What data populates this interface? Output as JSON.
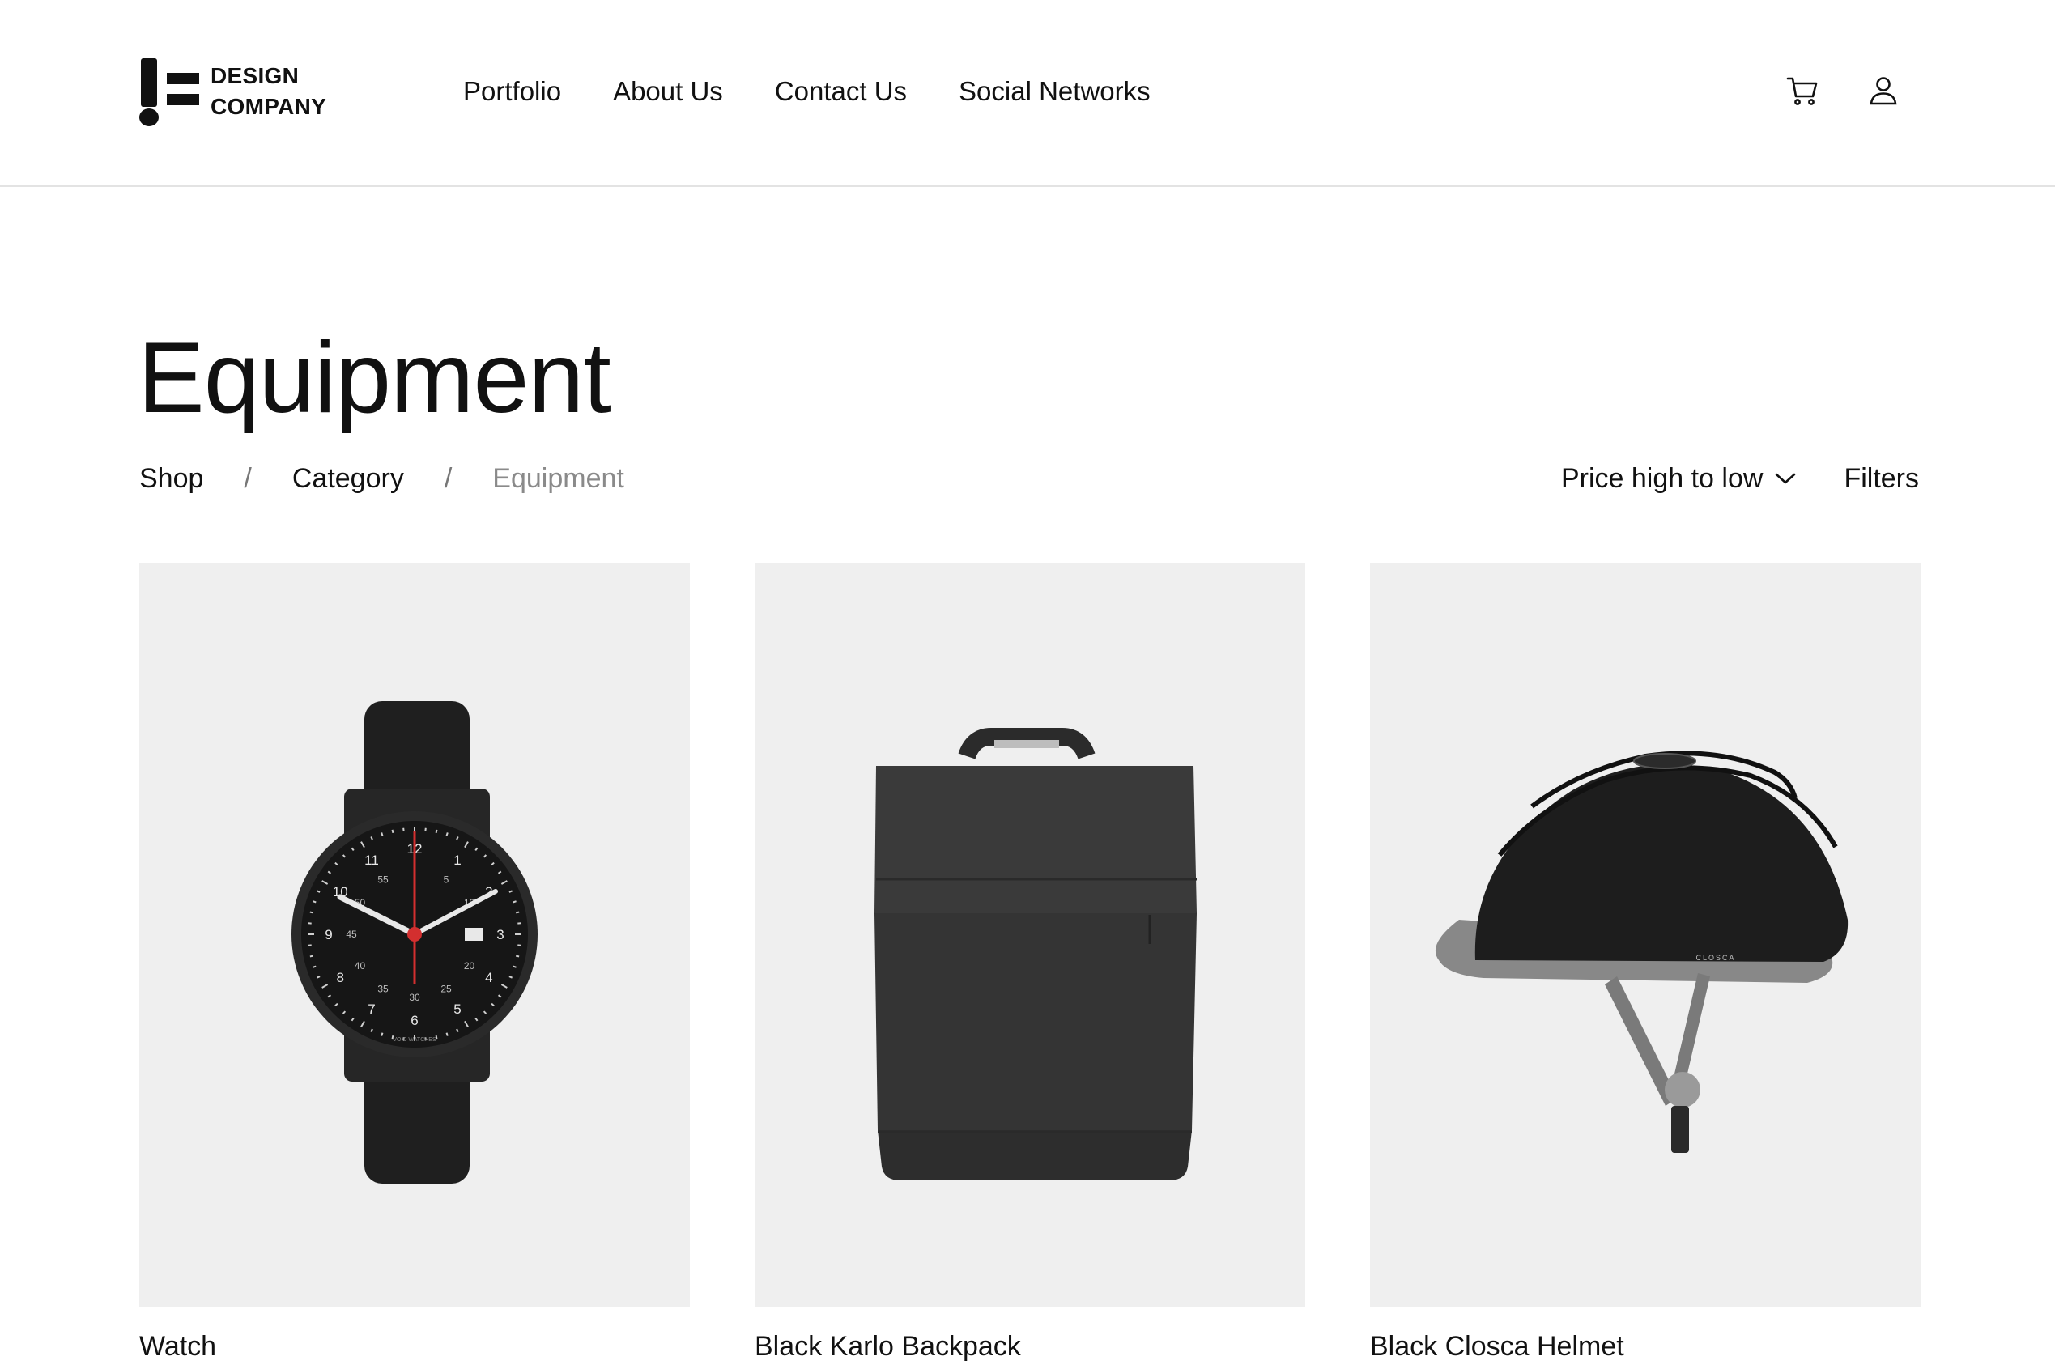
{
  "header": {
    "logo_line1": "DESIGN",
    "logo_line2": "COMPANY",
    "nav": [
      "Portfolio",
      "About Us",
      "Contact Us",
      "Social Networks"
    ],
    "icons": [
      "cart-icon",
      "user-icon"
    ]
  },
  "page": {
    "title": "Equipment",
    "breadcrumb": [
      "Shop",
      "Category",
      "Equipment"
    ],
    "breadcrumb_separator": "/",
    "sort_label": "Price high to low",
    "filters_label": "Filters"
  },
  "products": [
    {
      "name": "Watch",
      "image": "watch"
    },
    {
      "name": "Black Karlo Backpack",
      "image": "backpack"
    },
    {
      "name": "Black Closca Helmet",
      "image": "helmet"
    }
  ],
  "colors": {
    "text": "#111111",
    "muted": "#8a8a8a",
    "card_bg": "#efefef",
    "divider": "#e3e3e3",
    "watch_second_hand": "#d32f2f"
  },
  "watch_face": {
    "hour_marks": [
      "12",
      "1",
      "2",
      "3",
      "4",
      "5",
      "6",
      "7",
      "8",
      "9",
      "10",
      "11"
    ],
    "minute_marks": [
      "55",
      "5",
      "45",
      "15",
      "40",
      "20",
      "35",
      "25",
      "30",
      "10",
      "50"
    ],
    "wordmark": "VOID WATCHES"
  },
  "helmet_brand": "CLOSCA"
}
